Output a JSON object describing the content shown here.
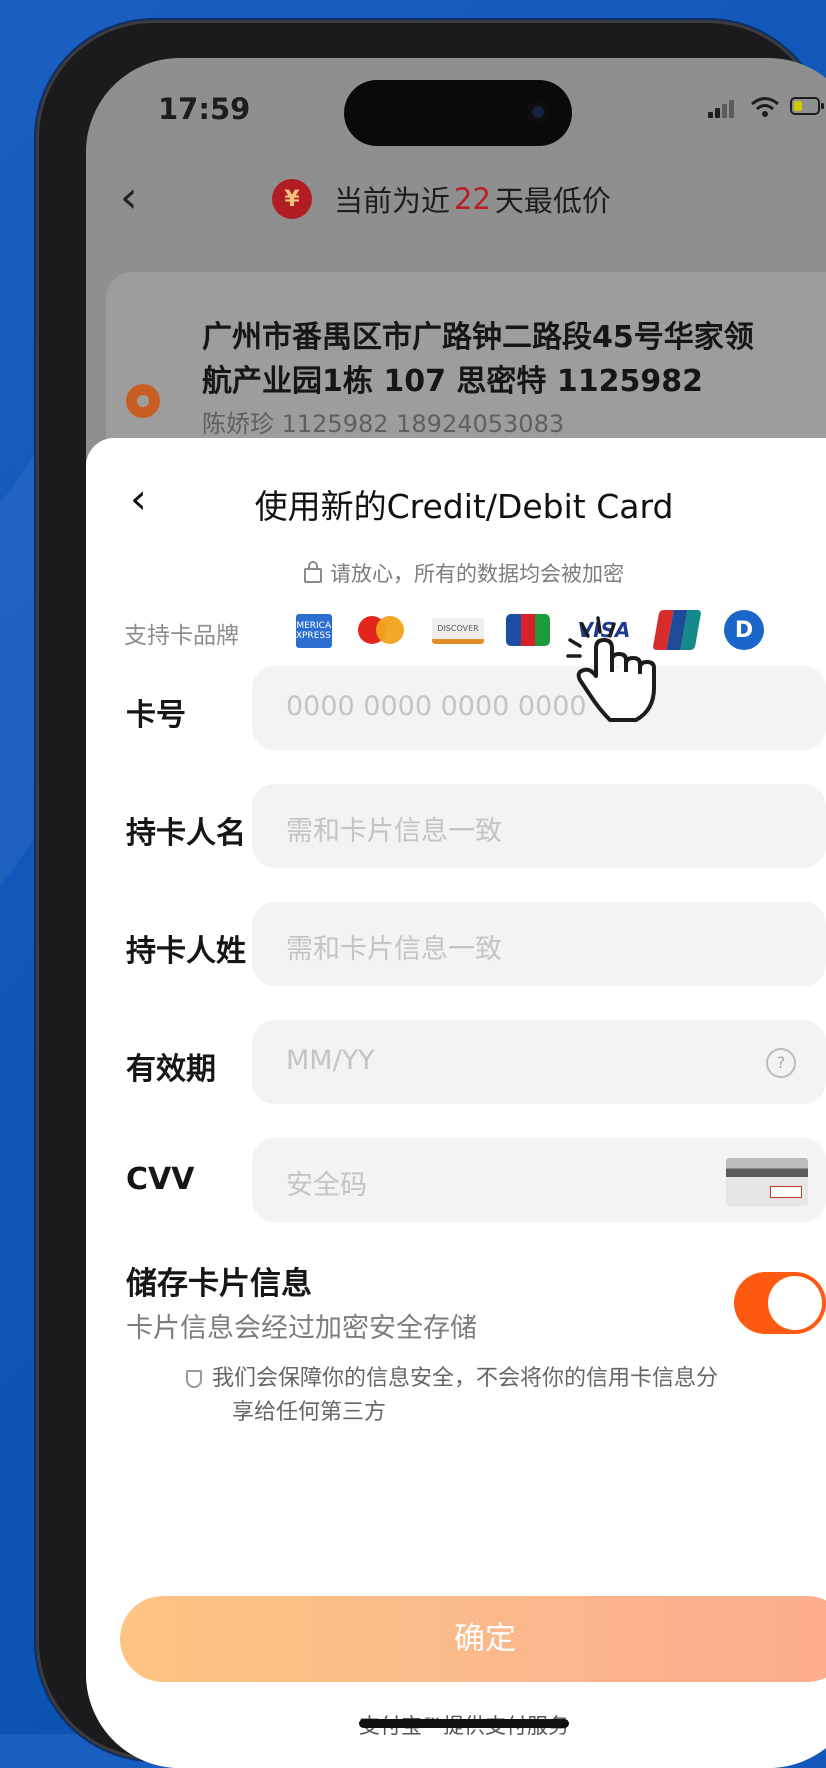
{
  "status_bar": {
    "time": "17:59"
  },
  "top_bar": {
    "prefix": "当前为近",
    "days": "22",
    "suffix": "天最低价",
    "coin_symbol": "¥"
  },
  "address": {
    "line1": "广州市番禺区市广路钟二路段45号华家领",
    "line2": "航产业园1栋 107 思密特 1125982",
    "contact": "陈娇珍 1125982 18924053083"
  },
  "sheet": {
    "title": "使用新的Credit/Debit Card",
    "secure_note": "请放心，所有的数据均会被加密",
    "brands_label": "支持卡品牌",
    "brands": {
      "amex": "AMERICAN EXPRESS",
      "discover": "DISCOVER",
      "visa": "VISA",
      "diners": "D"
    }
  },
  "fields": {
    "card_number": {
      "label": "卡号",
      "placeholder": "0000 0000 0000 0000"
    },
    "first_name": {
      "label": "持卡人名",
      "placeholder": "需和卡片信息一致"
    },
    "last_name": {
      "label": "持卡人姓",
      "placeholder": "需和卡片信息一致"
    },
    "expiry": {
      "label": "有效期",
      "placeholder": "MM/YY",
      "help": "?"
    },
    "cvv": {
      "label": "CVV",
      "placeholder": "安全码"
    }
  },
  "save_card": {
    "title": "储存卡片信息",
    "desc": "卡片信息会经过加密安全存储",
    "enabled": true
  },
  "privacy": {
    "line1": "我们会保障你的信息安全，不会将你的信用卡信息分",
    "line2": "享给任何第三方"
  },
  "confirm_label": "确定",
  "powered_by": "支付宝™提供支付服务",
  "colors": {
    "accent": "#ff5a12",
    "price_red": "#b81f25",
    "confirm_start": "#fdc581",
    "confirm_end": "#fbac8d"
  }
}
